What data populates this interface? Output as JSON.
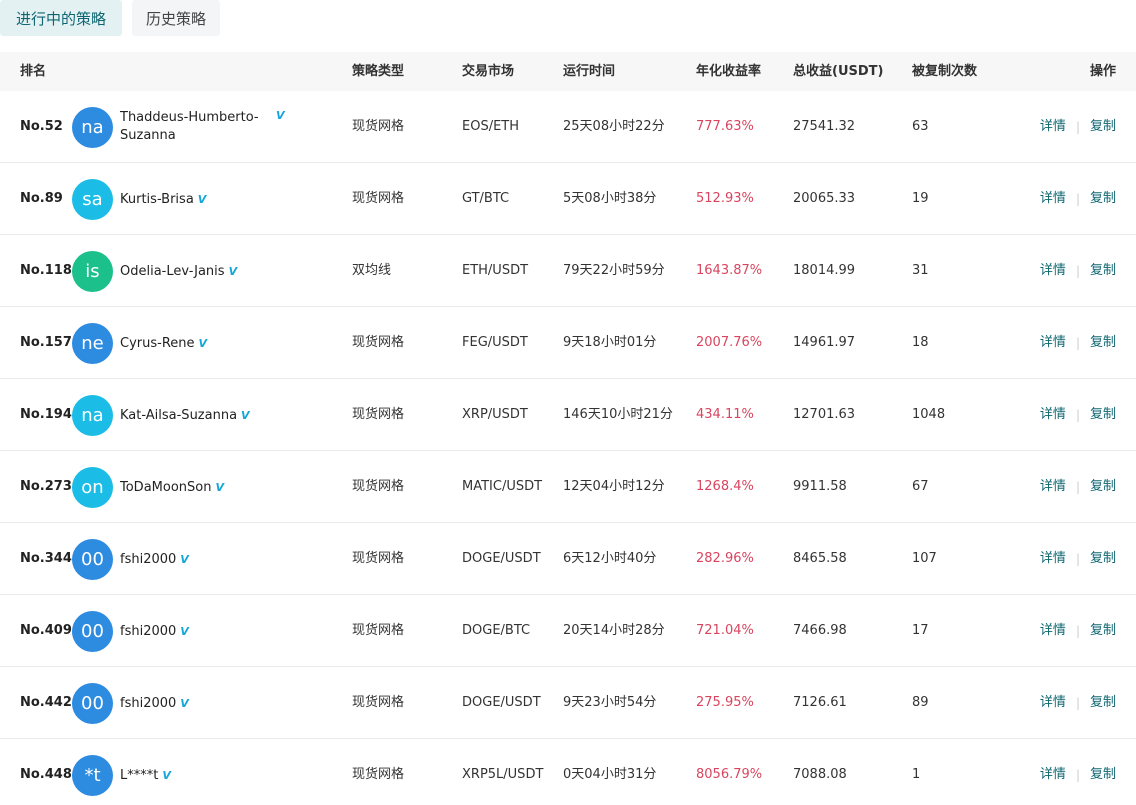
{
  "tabs": [
    {
      "label": "进行中的策略",
      "active": true
    },
    {
      "label": "历史策略",
      "active": false
    }
  ],
  "columns": {
    "rank": "排名",
    "type": "策略类型",
    "market": "交易市场",
    "runtime": "运行时间",
    "apy": "年化收益率",
    "profit": "总收益(USDT)",
    "copies": "被复制次数",
    "actions": "操作"
  },
  "action_labels": {
    "detail": "详情",
    "copy": "复制"
  },
  "verified_icon": "verified-badge-icon",
  "colors": {
    "accent": "#0f6670",
    "apy": "#d9455f",
    "verify": "#14a6d9"
  },
  "rows": [
    {
      "rank": "No.52",
      "avatar": "na",
      "avatar_color": "#2d8be0",
      "name": "Thaddeus-Humberto-Suzanna",
      "type": "现货网格",
      "market": "EOS/ETH",
      "runtime": "25天08小时22分",
      "apy": "777.63%",
      "profit": "27541.32",
      "copies": "63"
    },
    {
      "rank": "No.89",
      "avatar": "sa",
      "avatar_color": "#1bbde6",
      "name": "Kurtis-Brisa",
      "type": "现货网格",
      "market": "GT/BTC",
      "runtime": "5天08小时38分",
      "apy": "512.93%",
      "profit": "20065.33",
      "copies": "19"
    },
    {
      "rank": "No.118",
      "avatar": "is",
      "avatar_color": "#1cc08a",
      "name": "Odelia-Lev-Janis",
      "type": "双均线",
      "market": "ETH/USDT",
      "runtime": "79天22小时59分",
      "apy": "1643.87%",
      "profit": "18014.99",
      "copies": "31"
    },
    {
      "rank": "No.157",
      "avatar": "ne",
      "avatar_color": "#2d8be0",
      "name": "Cyrus-Rene",
      "type": "现货网格",
      "market": "FEG/USDT",
      "runtime": "9天18小时01分",
      "apy": "2007.76%",
      "profit": "14961.97",
      "copies": "18"
    },
    {
      "rank": "No.194",
      "avatar": "na",
      "avatar_color": "#1bbde6",
      "name": "Kat-Ailsa-Suzanna",
      "type": "现货网格",
      "market": "XRP/USDT",
      "runtime": "146天10小时21分",
      "apy": "434.11%",
      "profit": "12701.63",
      "copies": "1048"
    },
    {
      "rank": "No.273",
      "avatar": "on",
      "avatar_color": "#1bbde6",
      "name": "ToDaMoonSon",
      "type": "现货网格",
      "market": "MATIC/USDT",
      "runtime": "12天04小时12分",
      "apy": "1268.4%",
      "profit": "9911.58",
      "copies": "67"
    },
    {
      "rank": "No.344",
      "avatar": "00",
      "avatar_color": "#2d8be0",
      "name": "fshi2000",
      "type": "现货网格",
      "market": "DOGE/USDT",
      "runtime": "6天12小时40分",
      "apy": "282.96%",
      "profit": "8465.58",
      "copies": "107"
    },
    {
      "rank": "No.409",
      "avatar": "00",
      "avatar_color": "#2d8be0",
      "name": "fshi2000",
      "type": "现货网格",
      "market": "DOGE/BTC",
      "runtime": "20天14小时28分",
      "apy": "721.04%",
      "profit": "7466.98",
      "copies": "17"
    },
    {
      "rank": "No.442",
      "avatar": "00",
      "avatar_color": "#2d8be0",
      "name": "fshi2000",
      "type": "现货网格",
      "market": "DOGE/USDT",
      "runtime": "9天23小时54分",
      "apy": "275.95%",
      "profit": "7126.61",
      "copies": "89"
    },
    {
      "rank": "No.448",
      "avatar": "*t",
      "avatar_color": "#2d8be0",
      "name": "L****t",
      "type": "现货网格",
      "market": "XRP5L/USDT",
      "runtime": "0天04小时31分",
      "apy": "8056.79%",
      "profit": "7088.08",
      "copies": "1"
    }
  ]
}
